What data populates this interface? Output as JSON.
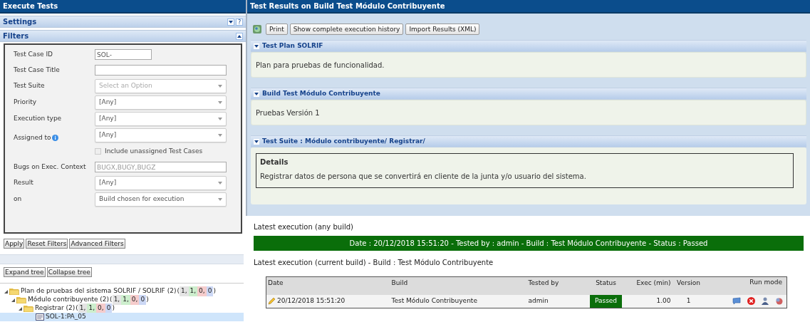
{
  "left_panel": {
    "title": "Execute Tests",
    "settings": {
      "title": "Settings",
      "expanded": false,
      "help": "?"
    },
    "filters": {
      "title": "Filters",
      "expanded": true,
      "fields": [
        {
          "kind": "short_text",
          "label": "Test Case ID",
          "value": "SOL-"
        },
        {
          "kind": "text",
          "label": "Test Case Title"
        },
        {
          "kind": "select",
          "label": "Test Suite",
          "placeholder": "Select an Option"
        },
        {
          "kind": "select",
          "label": "Priority",
          "value": "[Any]"
        },
        {
          "kind": "select",
          "label": "Execution type",
          "value": "[Any]"
        },
        {
          "kind": "select",
          "label": "Assigned to",
          "value": "[Any]",
          "info": true
        },
        {
          "kind": "checkbox",
          "label": "Include unassigned Test Cases",
          "checked": false
        },
        {
          "kind": "text",
          "label": "Bugs on Exec. Context",
          "placeholder": "BUGX,BUGY,BUGZ"
        },
        {
          "kind": "select",
          "label": "Result",
          "value": "[Any]"
        },
        {
          "kind": "select",
          "label": "on",
          "value": "Build chosen for execution"
        }
      ],
      "buttons": [
        "Apply",
        "Reset Filters",
        "Advanced Filters"
      ]
    },
    "tree_buttons": [
      "Expand tree",
      "Collapse tree"
    ],
    "tree": [
      {
        "kind": "folder",
        "label": "Plan de pruebas del sistema SOLRIF / SOLRIF (2)",
        "expanded": true,
        "selected": false,
        "counts_open": "(",
        "counts_close": ")",
        "counts": [
          {
            "text": "1,",
            "color": "#e4e4e4"
          },
          {
            "text": "1,",
            "color": "#cdeecd"
          },
          {
            "text": "0,",
            "color": "#f5cccc"
          },
          {
            "text": "0",
            "color": "#ccd8f5"
          }
        ],
        "children": [
          {
            "kind": "folder",
            "label": "Módulo contribuyente (2)",
            "expanded": true,
            "selected": false,
            "counts_open": "(",
            "counts_close": ")",
            "counts": [
              {
                "text": "1,",
                "color": "#e4e4e4"
              },
              {
                "text": "1,",
                "color": "#cdeecd"
              },
              {
                "text": "0,",
                "color": "#f5cccc"
              },
              {
                "text": "0",
                "color": "#ccd8f5"
              }
            ],
            "children": [
              {
                "kind": "folder",
                "label": "Registrar (2)",
                "expanded": true,
                "selected": false,
                "counts_open": "(",
                "counts_close": ")",
                "counts": [
                  {
                    "text": "1,",
                    "color": "#e4e4e4"
                  },
                  {
                    "text": "1,",
                    "color": "#cdeecd"
                  },
                  {
                    "text": "0,",
                    "color": "#f5cccc"
                  },
                  {
                    "text": "0",
                    "color": "#ccd8f5"
                  }
                ],
                "children": [
                  {
                    "kind": "testcase",
                    "label": "SOL-1:PA_05",
                    "selected": true
                  }
                ]
              }
            ]
          }
        ]
      }
    ]
  },
  "right_panel": {
    "title": "Test Results on Build Test Módulo Contribuyente",
    "toolbar": [
      "Print",
      "Show complete execution history",
      "Import Results (XML)"
    ],
    "sections": [
      {
        "kind": "text",
        "title": "Test Plan SOLRIF",
        "expanded": true,
        "body": "Plan para pruebas de funcionalidad."
      },
      {
        "kind": "text",
        "title": "Build Test Módulo Contribuyente",
        "expanded": true,
        "body": "Pruebas Versión 1"
      },
      {
        "kind": "details",
        "title": "Test Suite : Módulo contribuyente/ Registrar/",
        "expanded": true,
        "details_title": "Details",
        "body": "Registrar datos de persona que se convertirá en cliente de la junta y/o usuario del sistema."
      }
    ],
    "latest_any_label": "Latest execution (any build)",
    "latest_banner": "Date : 20/12/2018 15:51:20 - Tested by : admin - Build : Test Módulo Contribuyente - Status : Passed",
    "latest_current_label": "Latest execution (current build) - Build : Test Módulo Contribuyente",
    "table": {
      "columns": [
        "Date",
        "Build",
        "Tested by",
        "Status",
        "Exec (min)",
        "Version",
        "Run mode"
      ],
      "rows": [
        {
          "date": "20/12/2018 15:51:20",
          "build": "Test Módulo Contribuyente",
          "tested_by": "admin",
          "status": "Passed",
          "exec": "1.00",
          "version": "1"
        }
      ]
    }
  }
}
